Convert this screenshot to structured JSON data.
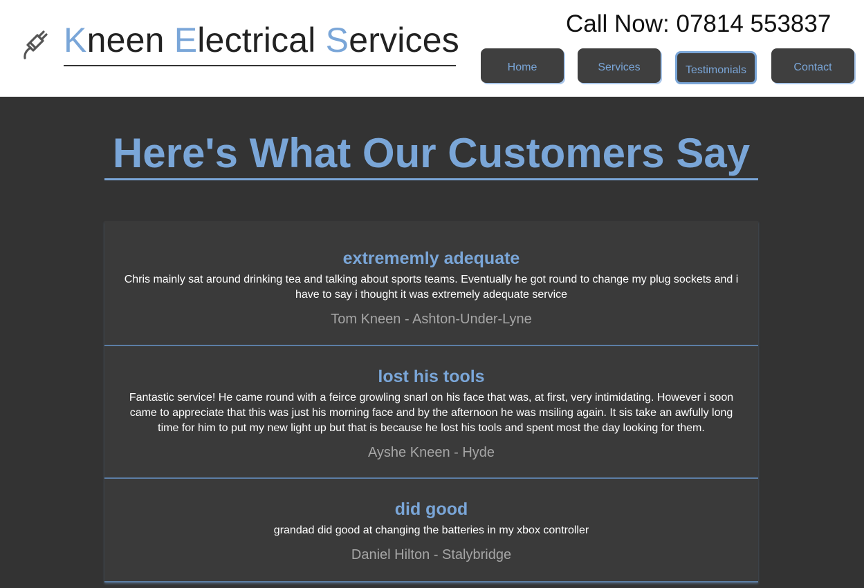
{
  "header": {
    "brand": {
      "letter_1": "K",
      "rest_1": "neen ",
      "letter_2": "E",
      "rest_2": "lectrical ",
      "letter_3": "S",
      "rest_3": "ervices"
    },
    "phone": "Call Now: 07814 553837",
    "logo_icon": "plug-icon",
    "accent_color": "#7aa6d8"
  },
  "nav": {
    "items": [
      {
        "label": "Home"
      },
      {
        "label": "Services"
      },
      {
        "label": "Testimonials",
        "active": true
      },
      {
        "label": "Contact"
      }
    ]
  },
  "main": {
    "title": "Here's What Our Customers Say",
    "reviews": [
      {
        "title": "extrememly adequate",
        "body": "Chris mainly sat around drinking tea and talking about sports teams. Eventually he got round to change my plug sockets and i have to say i thought it was extremely adequate service",
        "author": "Tom Kneen - Ashton-Under-Lyne"
      },
      {
        "title": "lost his tools",
        "body": "Fantastic service! He came round with a feirce growling snarl on his face that was, at first, very intimidating. However i soon came to appreciate that this was just his morning face and by the afternoon he was msiling again. It sis take an awfully long time for him to put my new light up but that is because he lost his tools and spent most the day looking for them.",
        "author": "Ayshe Kneen - Hyde"
      },
      {
        "title": "did good",
        "body": "grandad did good at changing the batteries in my xbox controller",
        "author": "Daniel Hilton - Stalybridge"
      }
    ]
  }
}
